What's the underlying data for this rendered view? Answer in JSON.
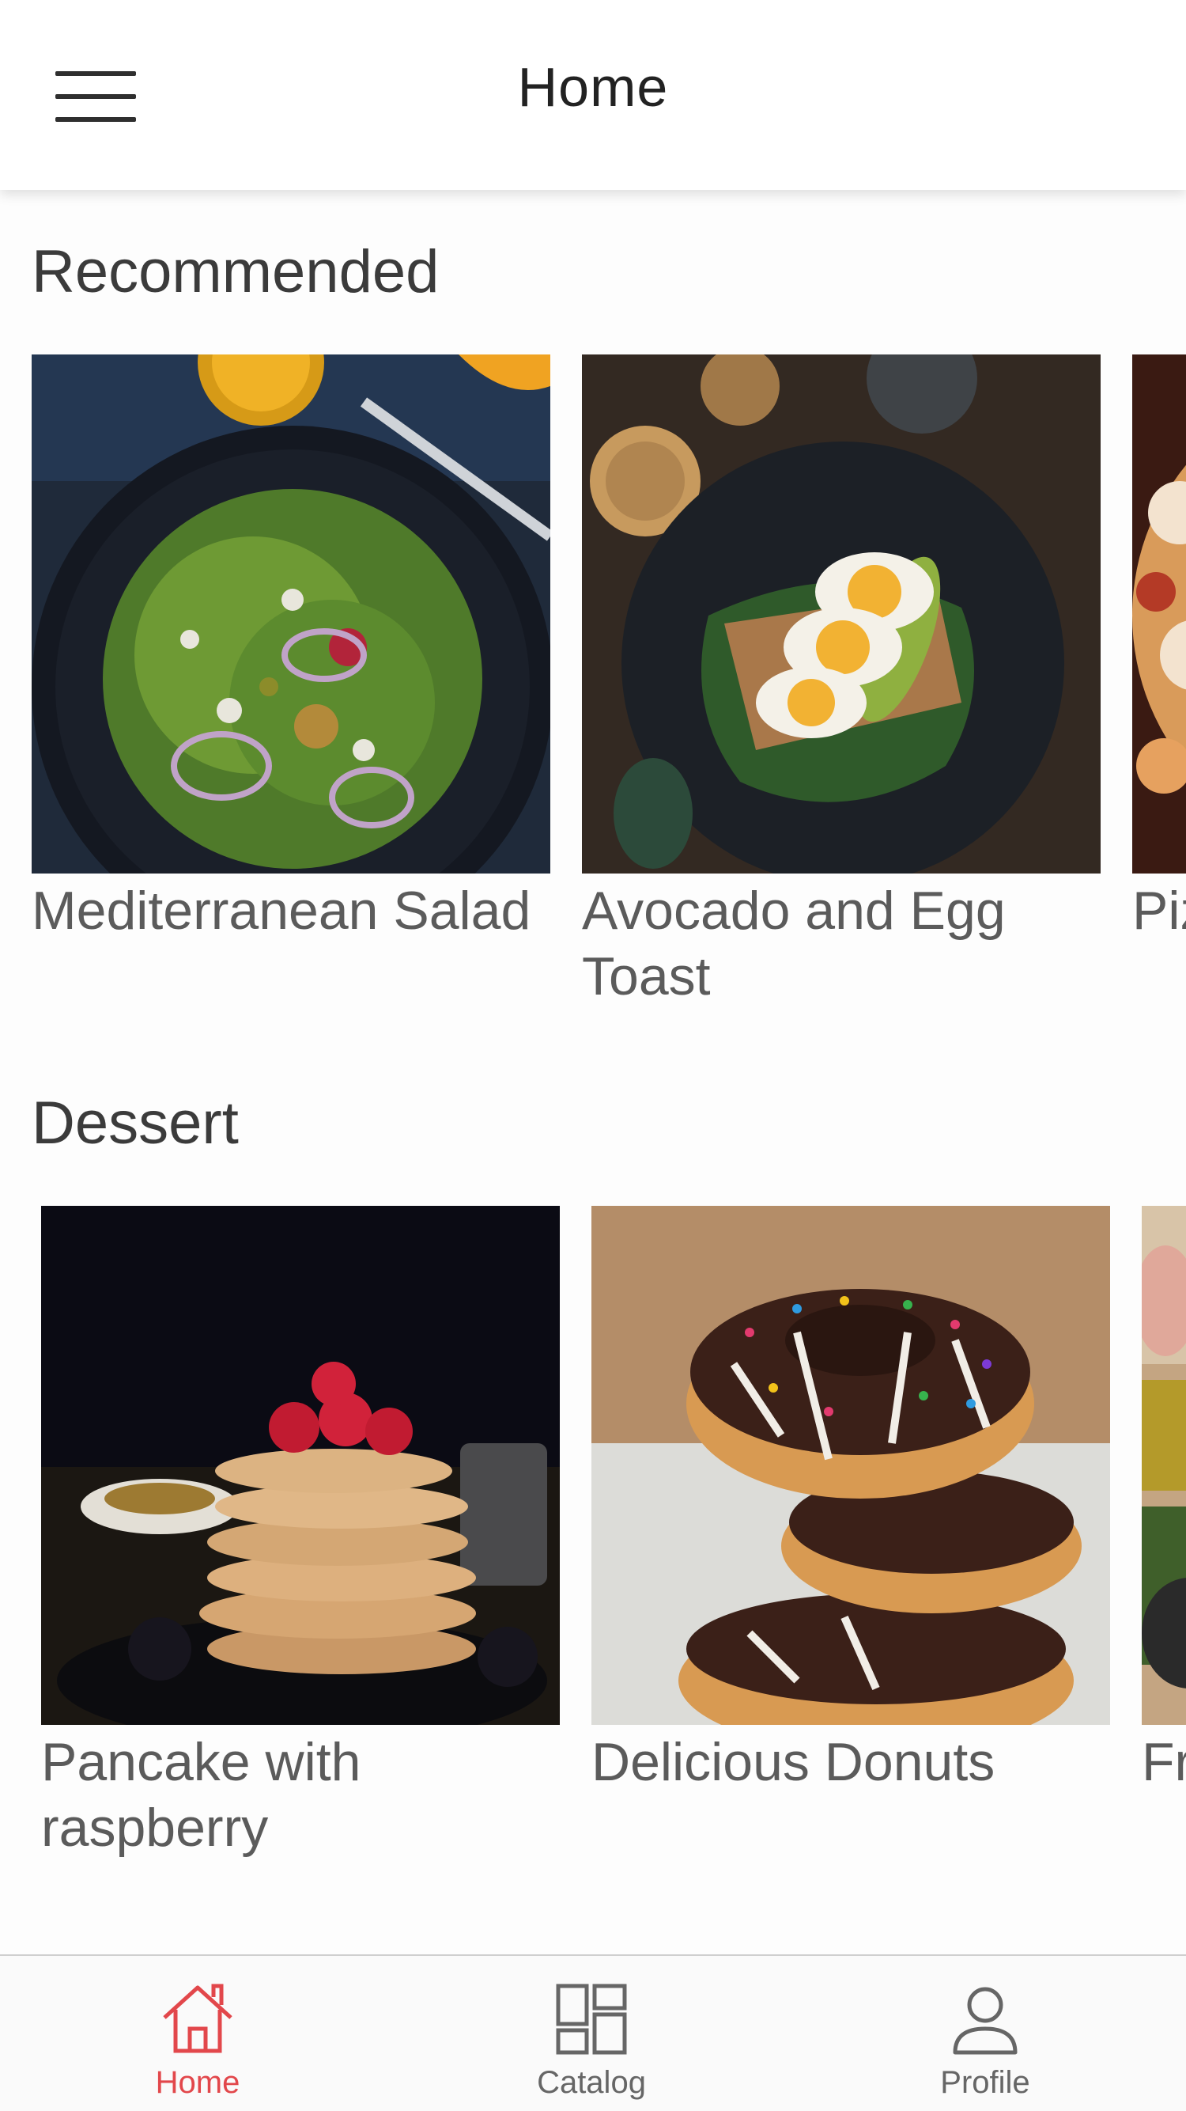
{
  "header": {
    "title": "Home"
  },
  "sections": [
    {
      "title": "Recommended",
      "items": [
        {
          "label": "Mediterranean Salad"
        },
        {
          "label": "Avocado and Egg Toast"
        },
        {
          "label": "Pizza"
        }
      ]
    },
    {
      "title": "Dessert",
      "items": [
        {
          "label": "Pancake with raspberry"
        },
        {
          "label": "Delicious Donuts"
        },
        {
          "label": "Fr"
        }
      ]
    }
  ],
  "bottom_nav": {
    "items": [
      {
        "label": "Home",
        "icon": "home-icon",
        "active": true
      },
      {
        "label": "Catalog",
        "icon": "catalog-icon",
        "active": false
      },
      {
        "label": "Profile",
        "icon": "profile-icon",
        "active": false
      }
    ],
    "active_color": "#e2474b",
    "inactive_color": "#666666"
  }
}
